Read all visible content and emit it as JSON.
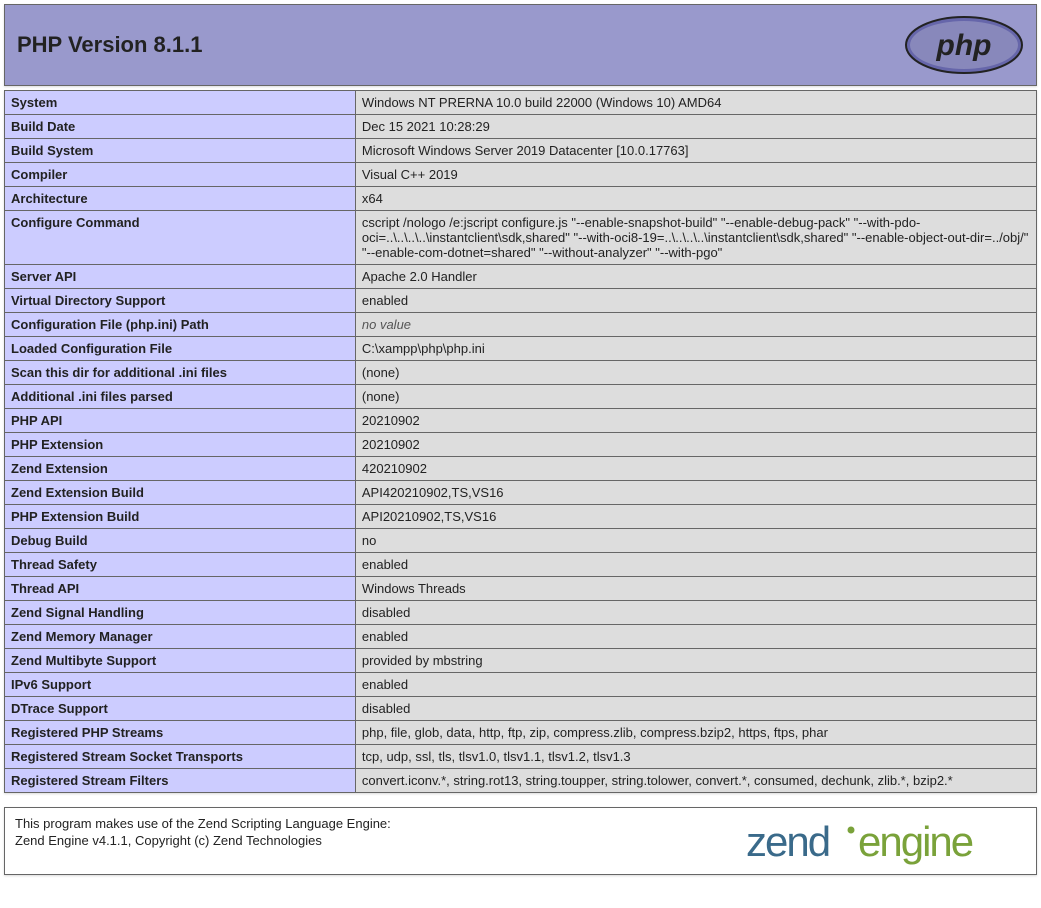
{
  "header": {
    "title": "PHP Version 8.1.1"
  },
  "rows": [
    {
      "label": "System",
      "value": "Windows NT PRERNA 10.0 build 22000 (Windows 10) AMD64"
    },
    {
      "label": "Build Date",
      "value": "Dec 15 2021 10:28:29"
    },
    {
      "label": "Build System",
      "value": "Microsoft Windows Server 2019 Datacenter [10.0.17763]"
    },
    {
      "label": "Compiler",
      "value": "Visual C++ 2019"
    },
    {
      "label": "Architecture",
      "value": "x64"
    },
    {
      "label": "Configure Command",
      "value": "cscript /nologo /e:jscript configure.js \"--enable-snapshot-build\" \"--enable-debug-pack\" \"--with-pdo-oci=..\\..\\..\\..\\instantclient\\sdk,shared\" \"--with-oci8-19=..\\..\\..\\..\\instantclient\\sdk,shared\" \"--enable-object-out-dir=../obj/\" \"--enable-com-dotnet=shared\" \"--without-analyzer\" \"--with-pgo\""
    },
    {
      "label": "Server API",
      "value": "Apache 2.0 Handler"
    },
    {
      "label": "Virtual Directory Support",
      "value": "enabled"
    },
    {
      "label": "Configuration File (php.ini) Path",
      "value": "no value",
      "novalue": true
    },
    {
      "label": "Loaded Configuration File",
      "value": "C:\\xampp\\php\\php.ini"
    },
    {
      "label": "Scan this dir for additional .ini files",
      "value": "(none)"
    },
    {
      "label": "Additional .ini files parsed",
      "value": "(none)"
    },
    {
      "label": "PHP API",
      "value": "20210902"
    },
    {
      "label": "PHP Extension",
      "value": "20210902"
    },
    {
      "label": "Zend Extension",
      "value": "420210902"
    },
    {
      "label": "Zend Extension Build",
      "value": "API420210902,TS,VS16"
    },
    {
      "label": "PHP Extension Build",
      "value": "API20210902,TS,VS16"
    },
    {
      "label": "Debug Build",
      "value": "no"
    },
    {
      "label": "Thread Safety",
      "value": "enabled"
    },
    {
      "label": "Thread API",
      "value": "Windows Threads"
    },
    {
      "label": "Zend Signal Handling",
      "value": "disabled"
    },
    {
      "label": "Zend Memory Manager",
      "value": "enabled"
    },
    {
      "label": "Zend Multibyte Support",
      "value": "provided by mbstring"
    },
    {
      "label": "IPv6 Support",
      "value": "enabled"
    },
    {
      "label": "DTrace Support",
      "value": "disabled"
    },
    {
      "label": "Registered PHP Streams",
      "value": "php, file, glob, data, http, ftp, zip, compress.zlib, compress.bzip2, https, ftps, phar"
    },
    {
      "label": "Registered Stream Socket Transports",
      "value": "tcp, udp, ssl, tls, tlsv1.0, tlsv1.1, tlsv1.2, tlsv1.3"
    },
    {
      "label": "Registered Stream Filters",
      "value": "convert.iconv.*, string.rot13, string.toupper, string.tolower, convert.*, consumed, dechunk, zlib.*, bzip2.*"
    }
  ],
  "zend": {
    "line1": "This program makes use of the Zend Scripting Language Engine:",
    "line2": "Zend Engine v4.1.1, Copyright (c) Zend Technologies"
  }
}
